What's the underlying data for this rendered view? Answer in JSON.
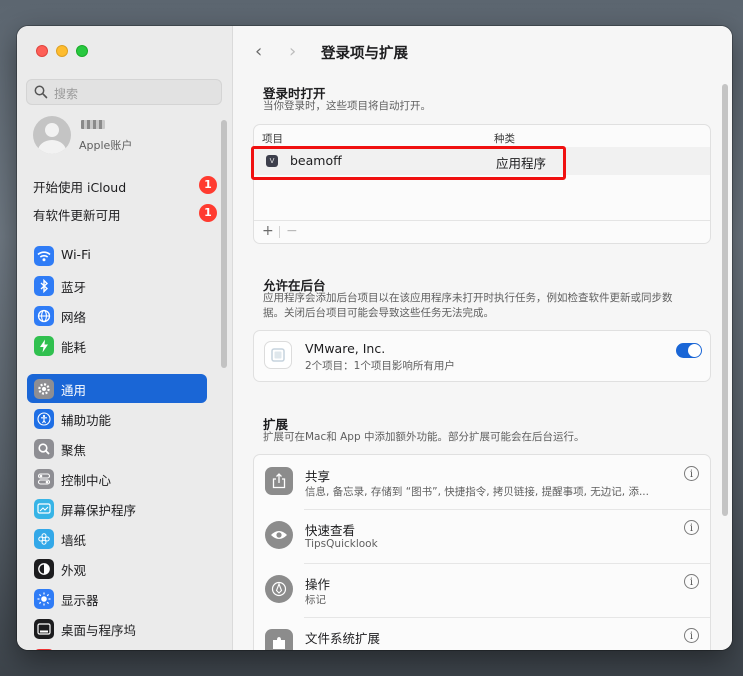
{
  "sidebar": {
    "search_placeholder": "搜索",
    "account_sub": "Apple账户",
    "notices": [
      {
        "label": "开始使用 iCloud",
        "badge": "1"
      },
      {
        "label": "有软件更新可用",
        "badge": "1"
      }
    ],
    "items": [
      {
        "label": "Wi-Fi"
      },
      {
        "label": "蓝牙"
      },
      {
        "label": "网络"
      },
      {
        "label": "能耗"
      },
      {
        "label": "通用"
      },
      {
        "label": "辅助功能"
      },
      {
        "label": "聚焦"
      },
      {
        "label": "控制中心"
      },
      {
        "label": "屏幕保护程序"
      },
      {
        "label": "墙纸"
      },
      {
        "label": "外观"
      },
      {
        "label": "显示器"
      },
      {
        "label": "桌面与程序坞"
      }
    ]
  },
  "header": {
    "back": "‹",
    "forward": "›",
    "title": "登录项与扩展"
  },
  "login_items": {
    "title": "登录时打开",
    "desc": "当你登录时，这些项目将自动打开。",
    "col_item": "项目",
    "col_kind": "种类",
    "rows": [
      {
        "name": "beamoff",
        "kind": "应用程序"
      }
    ],
    "add": "+",
    "remove": "−"
  },
  "background": {
    "title": "允许在后台",
    "desc": "应用程序会添加后台项目以在该应用程序未打开时执行任务，例如检查软件更新或同步数据。关闭后台项目可能会导致这些任务无法完成。",
    "items": [
      {
        "name": "VMware, Inc.",
        "desc": "2个项目：1个项目影响所有用户",
        "enabled": true
      }
    ]
  },
  "extensions": {
    "title": "扩展",
    "desc": "扩展可在Mac和 App 中添加额外功能。部分扩展可能会在后台运行。",
    "items": [
      {
        "name": "共享",
        "desc": "信息, 备忘录, 存储到 “图书”, 快捷指令, 拷贝链接, 提醒事项, 无边记, 添..."
      },
      {
        "name": "快速查看",
        "desc": "TipsQuicklook"
      },
      {
        "name": "操作",
        "desc": "标记"
      },
      {
        "name": "文件系统扩展",
        "desc": ""
      }
    ]
  },
  "colors": {
    "accent": "#1a66d6",
    "highlight_box": "#f01010",
    "badge": "#ff3b30"
  }
}
